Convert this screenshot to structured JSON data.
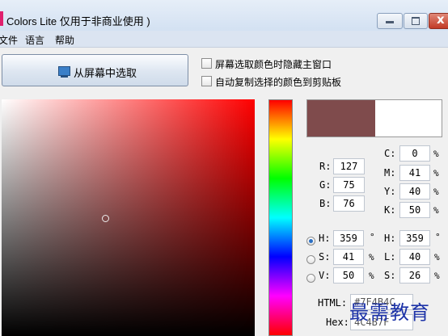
{
  "window": {
    "title": "Colors Lite 仅用于非商业使用 )",
    "controls": {
      "minimize": "minimize",
      "maximize": "maximize",
      "close": "x"
    }
  },
  "menu": {
    "items": [
      "文件",
      "语言",
      "帮助"
    ]
  },
  "pick_button": {
    "label": "从屏幕中选取",
    "icon": "monitor-icon"
  },
  "options": [
    {
      "label": "屏幕选取颜色时隐藏主窗口",
      "checked": false
    },
    {
      "label": "自动复制选择的颜色到剪贴板",
      "checked": false
    }
  ],
  "preview": {
    "current_color": "#7f4b4c",
    "previous_color": "#ffffff"
  },
  "picker": {
    "cursor_saturation_pct": 41,
    "cursor_value_pct": 50
  },
  "rgb": {
    "R": {
      "label": "R:",
      "value": "127"
    },
    "G": {
      "label": "G:",
      "value": "75"
    },
    "B": {
      "label": "B:",
      "value": "76"
    }
  },
  "cmyk": {
    "C": {
      "label": "C:",
      "value": "0",
      "unit": "%"
    },
    "M": {
      "label": "M:",
      "value": "41",
      "unit": "%"
    },
    "Y": {
      "label": "Y:",
      "value": "40",
      "unit": "%"
    },
    "K": {
      "label": "K:",
      "value": "50",
      "unit": "%"
    }
  },
  "hsv": {
    "H": {
      "label": "H:",
      "value": "359",
      "unit": "°",
      "selected": true
    },
    "S": {
      "label": "S:",
      "value": "41",
      "unit": "%",
      "selected": false
    },
    "V": {
      "label": "V:",
      "value": "50",
      "unit": "%",
      "selected": false
    }
  },
  "hsl": {
    "H": {
      "label": "H:",
      "value": "359",
      "unit": "°"
    },
    "L": {
      "label": "L:",
      "value": "40",
      "unit": "%"
    },
    "S": {
      "label": "S:",
      "value": "26",
      "unit": "%"
    }
  },
  "codes": {
    "html_label": "HTML:",
    "html_value": "#7F4B4C",
    "hex_label": "Hex:",
    "hex_value": "4C4B7F"
  },
  "watermark": "最需教育"
}
